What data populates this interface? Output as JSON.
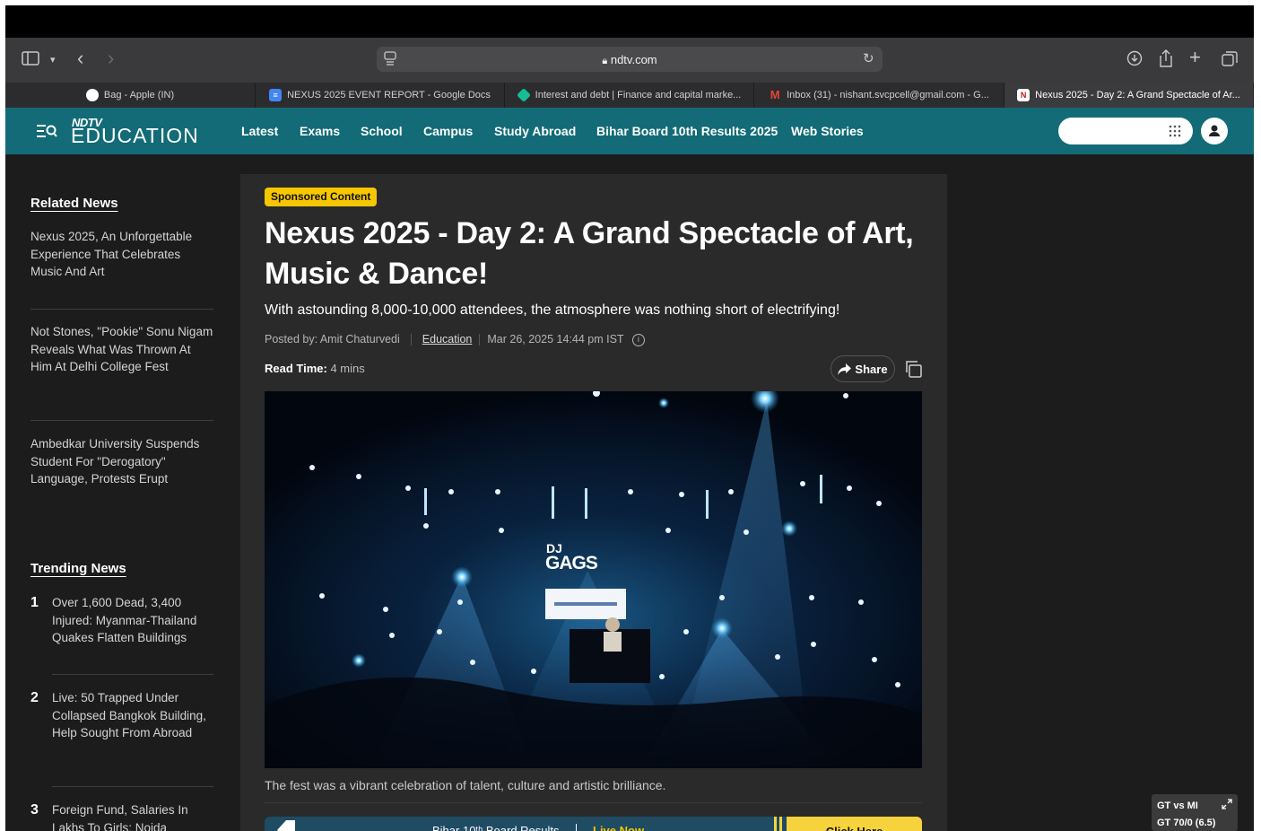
{
  "browser": {
    "url": "ndtv.com",
    "tabs": [
      {
        "label": "Bag - Apple (IN)"
      },
      {
        "label": "NEXUS 2025 EVENT REPORT - Google Docs"
      },
      {
        "label": "Interest and debt | Finance and capital marke..."
      },
      {
        "label": "Inbox (31) - nishant.svcpcell@gmail.com - G..."
      },
      {
        "label": "Nexus 2025 - Day 2: A Grand Spectacle of Ar..."
      }
    ]
  },
  "site": {
    "logo_top": "NDTV",
    "logo_main": "EDUCATION",
    "nav": [
      "Latest",
      "Exams",
      "School",
      "Campus",
      "Study Abroad",
      "Bihar Board 10th Results 2025",
      "Web Stories"
    ]
  },
  "sidebar": {
    "related_heading": "Related News",
    "related": [
      "Nexus 2025, An Unforgettable Experience That Celebrates Music And Art",
      "Not Stones, \"Pookie\" Sonu Nigam Reveals What Was Thrown At Him At Delhi College Fest",
      "Ambedkar University Suspends Student For \"Derogatory\" Language, Protests Erupt"
    ],
    "trending_heading": "Trending News",
    "trending": [
      {
        "num": "1",
        "text": "Over 1,600 Dead, 3,400 Injured: Myanmar-Thailand Quakes Flatten Buildings"
      },
      {
        "num": "2",
        "text": "Live: 50 Trapped Under Collapsed Bangkok Building, Help Sought From Abroad"
      },
      {
        "num": "3",
        "text": "Foreign Fund, Salaries In Lakhs To Girls: Noida"
      }
    ]
  },
  "article": {
    "badge": "Sponsored Content",
    "title": "Nexus 2025 - Day 2: A Grand Spectacle of Art, Music & Dance!",
    "subtitle": "With astounding 8,000-10,000 attendees, the atmosphere was nothing short of electrifying!",
    "posted_by": "Posted by: Amit Chaturvedi",
    "category": "Education",
    "date": "Mar 26, 2025 14:44 pm IST",
    "read_time_label": "Read Time:",
    "read_time_value": "4 mins",
    "share_label": "Share",
    "hero_stage_text_1": "DJ",
    "hero_stage_text_2": "GAGS",
    "caption": "The fest was a vibrant celebration of talent, culture and artistic brilliance.",
    "banner_text": "Bihar 10ᵗʰ Board Results",
    "banner_live": "Live Now",
    "banner_cta": "Click Here"
  },
  "score_widget": {
    "match": "GT vs MI",
    "score": "GT 70/0 (6.5)"
  }
}
